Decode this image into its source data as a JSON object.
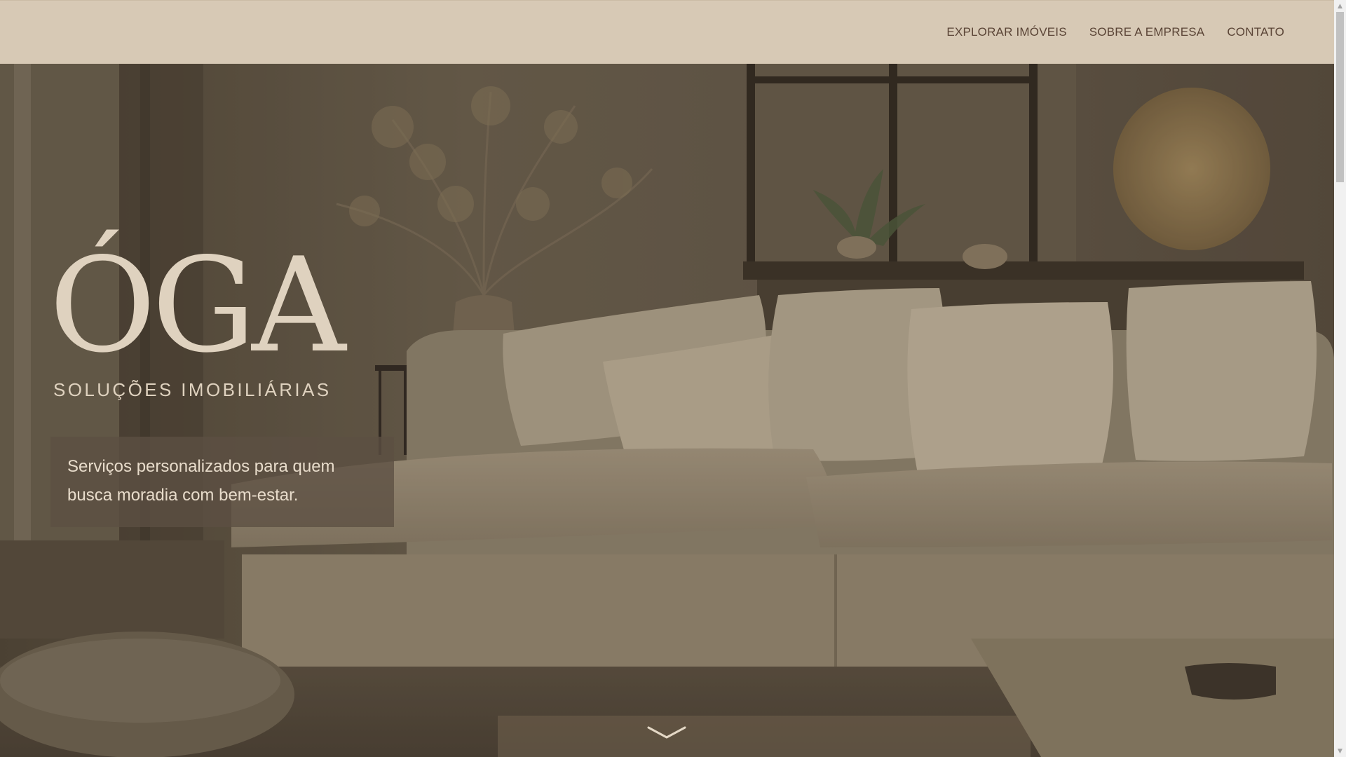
{
  "nav": {
    "items": [
      {
        "label": "EXPLORAR IMÓVEIS"
      },
      {
        "label": "SOBRE A EMPRESA"
      },
      {
        "label": "CONTATO"
      }
    ]
  },
  "hero": {
    "logo_word": "ÓGA",
    "logo_subtitle": "SOLUÇÕES IMOBILIÁRIAS",
    "tagline": "Serviços personalizados para quem busca moradia com bem-estar.",
    "background_description_icon": "living-room-photo",
    "scroll_icon": "chevron-down-icon"
  },
  "colors": {
    "header_bg": "#d7c9b5",
    "nav_text": "#5a4436",
    "logo": "#dfd2bf",
    "tagline_text": "#e8dccb"
  },
  "scrollbar": {
    "up_glyph": "▲",
    "down_glyph": "▼"
  }
}
